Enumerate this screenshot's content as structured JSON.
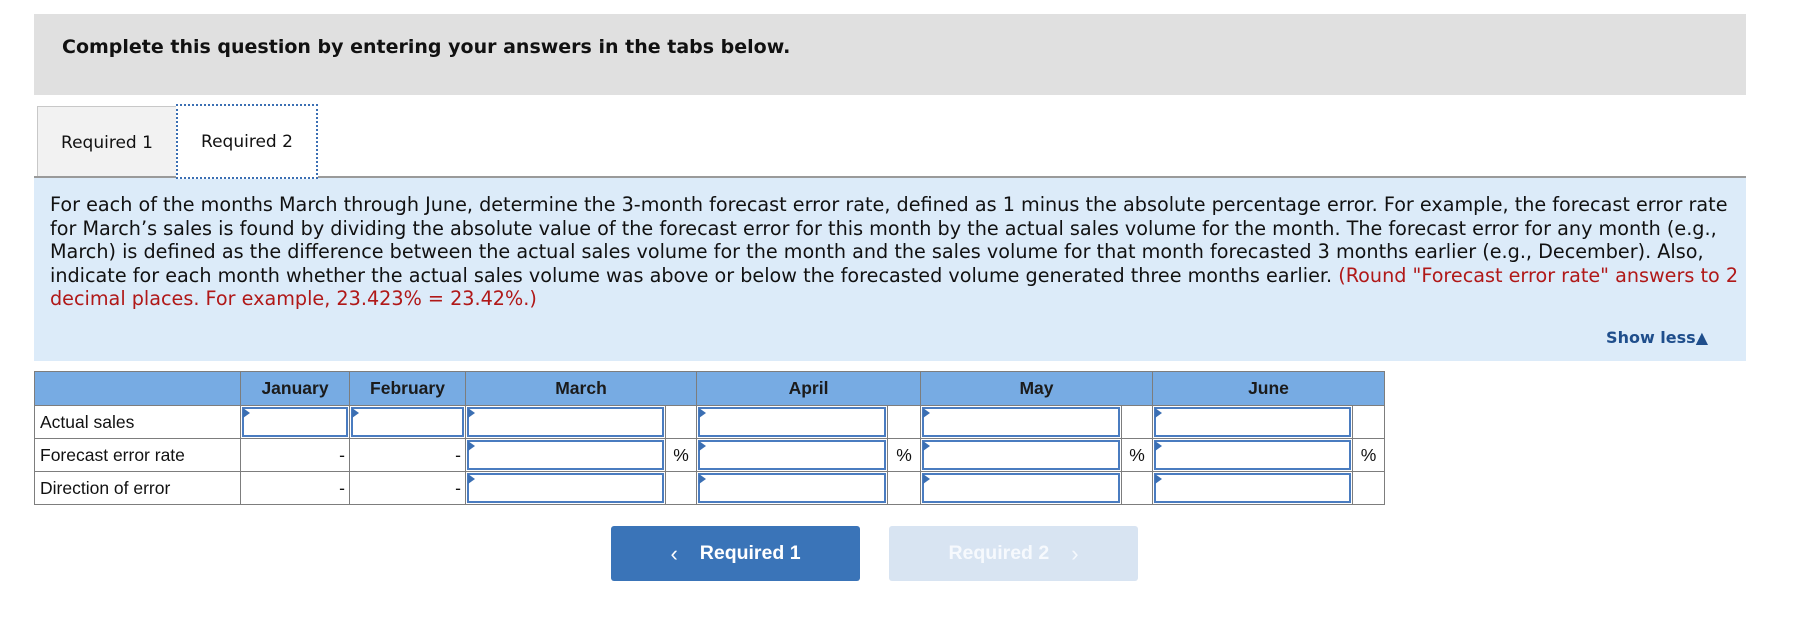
{
  "banner": {
    "title": "Complete this question by entering your answers in the tabs below."
  },
  "tabs": [
    {
      "label": "Required 1",
      "active": false
    },
    {
      "label": "Required 2",
      "active": true
    }
  ],
  "instructions": {
    "text": "For each of the months March through June, determine the 3-month forecast error rate, defined as 1 minus the absolute percentage error. For example, the forecast error rate for March’s sales is found by dividing the absolute value of the forecast error for this month by the actual sales volume for the month. The forecast error for any month (e.g., March) is defined as the difference between the actual sales volume for the month and the sales volume for that month forecasted 3 months earlier (e.g., December). Also, indicate for each month whether the actual sales volume was above or below the forecasted volume generated three months earlier. ",
    "note": "(Round \"Forecast error rate\" answers to 2 decimal places. For example, 23.423% = 23.42%.)",
    "show_less": "Show less",
    "show_less_icon": "▲"
  },
  "table": {
    "columns": [
      "",
      "January",
      "February",
      "March",
      "April",
      "May",
      "June"
    ],
    "rows": [
      {
        "label": "Actual sales",
        "january": "",
        "february": "",
        "march": "",
        "april": "",
        "may": "",
        "june": ""
      },
      {
        "label": "Forecast error rate",
        "january": "-",
        "february": "-",
        "march": "",
        "april": "",
        "may": "",
        "june": "",
        "unit": "%"
      },
      {
        "label": "Direction of error",
        "january": "-",
        "february": "-",
        "march": "",
        "april": "",
        "may": "",
        "june": ""
      }
    ]
  },
  "nav": {
    "prev_label": "Required 1",
    "prev_icon": "‹",
    "next_label": "Required 2",
    "next_icon": "›"
  },
  "colors": {
    "accent": "#3a74b8",
    "header_bg": "#77abe3",
    "panel_bg": "#dcebf9",
    "note_red": "#b01818",
    "link": "#1f4e8c"
  }
}
